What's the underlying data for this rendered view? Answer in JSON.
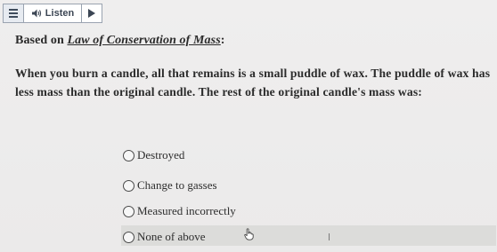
{
  "toolbar": {
    "menu_icon": "hamburger-menu-icon",
    "listen_icon": "speaker-icon",
    "listen_label": "Listen",
    "play_icon": "play-triangle-icon"
  },
  "prompt": {
    "prefix": "Based on ",
    "link_text": "Law of Conservation of Mass",
    "suffix": ":"
  },
  "question": {
    "text": "When you burn a candle, all that remains is a small puddle of wax. The puddle of wax has less mass than the original candle. The rest of the original candle's mass was:"
  },
  "options": [
    {
      "label": "Destroyed",
      "selected": false
    },
    {
      "label": "Change to gasses",
      "selected": false
    },
    {
      "label": "Measured incorrectly",
      "selected": false
    },
    {
      "label": "None of above",
      "selected": false,
      "hovered": true
    }
  ],
  "cursor": "hand-pointer-icon",
  "colors": {
    "background": "#eeeded",
    "hover_highlight": "#dcdcda",
    "toolbar_border": "#9aa3b0",
    "text": "#2b2b2b"
  }
}
